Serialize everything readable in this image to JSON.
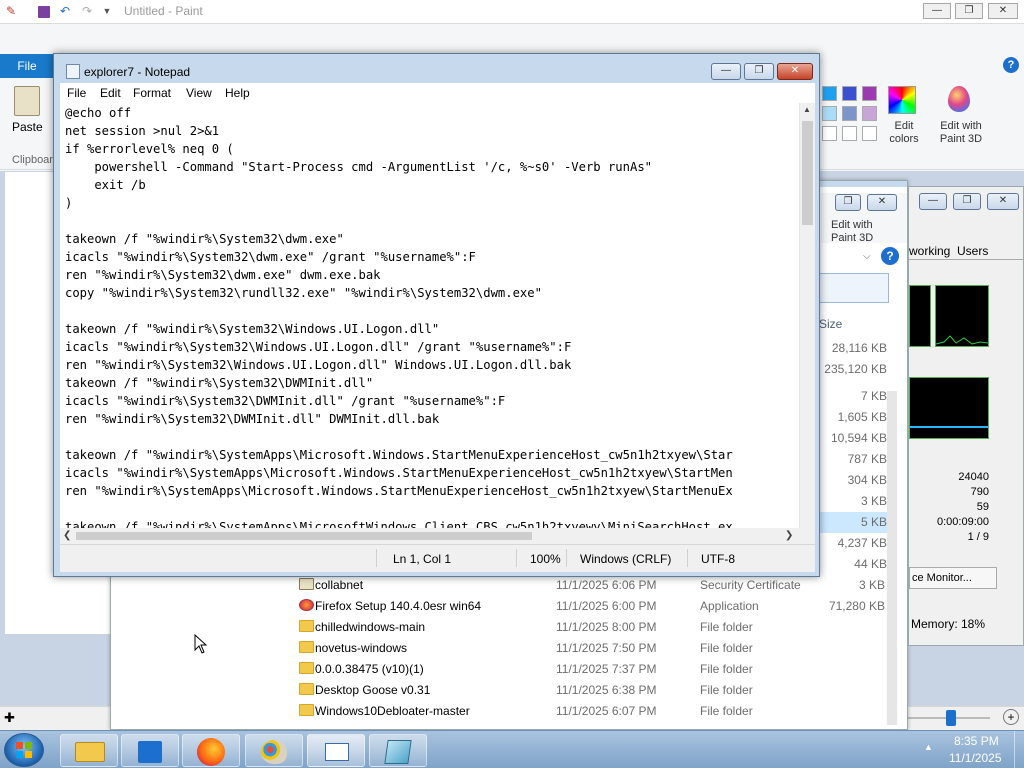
{
  "paint": {
    "title": "Untitled - Paint",
    "file_tab": "File",
    "paste_label": "Paste",
    "clipboard_group": "Clipboard",
    "edit_colors": "Edit colors",
    "edit_with_paint3d": "Edit with Paint 3D",
    "icons": [
      "save-icon",
      "undo-icon",
      "redo-icon",
      "help-icon"
    ]
  },
  "explorer": {
    "edit_paint3d": "Edit with Paint 3D",
    "size_header": "Size",
    "sizes": [
      "28,116 KB",
      "235,120 KB",
      "7 KB",
      "1,605 KB",
      "10,594 KB",
      "787 KB",
      "304 KB",
      "3 KB",
      "5 KB",
      "4,237 KB",
      "44 KB",
      "3 KB",
      "71,280 KB"
    ],
    "rows": [
      {
        "name": "collabnet",
        "date": "11/1/2025 6:06 PM",
        "type": "Security Certificate",
        "size": "3 KB"
      },
      {
        "name": "Firefox Setup 140.4.0esr win64",
        "date": "11/1/2025 6:00 PM",
        "type": "Application",
        "size": "71,280 KB"
      },
      {
        "name": "chilledwindows-main",
        "date": "11/1/2025 8:00 PM",
        "type": "File folder",
        "size": ""
      },
      {
        "name": "novetus-windows",
        "date": "11/1/2025 7:50 PM",
        "type": "File folder",
        "size": ""
      },
      {
        "name": "0.0.0.38475 (v10)(1)",
        "date": "11/1/2025 7:37 PM",
        "type": "File folder",
        "size": ""
      },
      {
        "name": "Desktop Goose v0.31",
        "date": "11/1/2025 6:38 PM",
        "type": "File folder",
        "size": ""
      },
      {
        "name": "Windows10Debloater-master",
        "date": "11/1/2025 6:07 PM",
        "type": "File folder",
        "size": ""
      }
    ]
  },
  "taskmanager": {
    "tabs": [
      "working",
      "Users"
    ],
    "stats": [
      "24040",
      "790",
      "59",
      "0:00:09:00",
      "1 / 9"
    ],
    "resource_monitor": "ce Monitor...",
    "memory": "Memory: 18%"
  },
  "notepad": {
    "title": "explorer7 - Notepad",
    "menu": [
      "File",
      "Edit",
      "Format",
      "View",
      "Help"
    ],
    "text": "@echo off\nnet session >nul 2>&1\nif %errorlevel% neq 0 (\n    powershell -Command \"Start-Process cmd -ArgumentList '/c, %~s0' -Verb runAs\"\n    exit /b\n)\n\ntakeown /f \"%windir%\\System32\\dwm.exe\"\nicacls \"%windir%\\System32\\dwm.exe\" /grant \"%username%\":F\nren \"%windir%\\System32\\dwm.exe\" dwm.exe.bak\ncopy \"%windir%\\System32\\rundll32.exe\" \"%windir%\\System32\\dwm.exe\"\n\ntakeown /f \"%windir%\\System32\\Windows.UI.Logon.dll\"\nicacls \"%windir%\\System32\\Windows.UI.Logon.dll\" /grant \"%username%\":F\nren \"%windir%\\System32\\Windows.UI.Logon.dll\" Windows.UI.Logon.dll.bak\ntakeown /f \"%windir%\\System32\\DWMInit.dll\"\nicacls \"%windir%\\System32\\DWMInit.dll\" /grant \"%username%\":F\nren \"%windir%\\System32\\DWMInit.dll\" DWMInit.dll.bak\n\ntakeown /f \"%windir%\\SystemApps\\Microsoft.Windows.StartMenuExperienceHost_cw5n1h2txyew\\Star\nicacls \"%windir%\\SystemApps\\Microsoft.Windows.StartMenuExperienceHost_cw5n1h2txyew\\StartMen\nren \"%windir%\\SystemApps\\Microsoft.Windows.StartMenuExperienceHost_cw5n1h2txyew\\StartMenuEx\n\ntakeown /f \"%windir%\\SystemApps\\MicrosoftWindows.Client.CBS_cw5n1h2txyewy\\MiniSearchHost.ex",
    "status": {
      "position": "Ln 1, Col 1",
      "zoom": "100%",
      "line_ending": "Windows (CRLF)",
      "encoding": "UTF-8"
    }
  },
  "taskbar": {
    "time": "8:35 PM",
    "date": "11/1/2025",
    "apps": [
      "file-explorer",
      "store",
      "firefox",
      "paint",
      "notepad-window",
      "notepad"
    ]
  }
}
